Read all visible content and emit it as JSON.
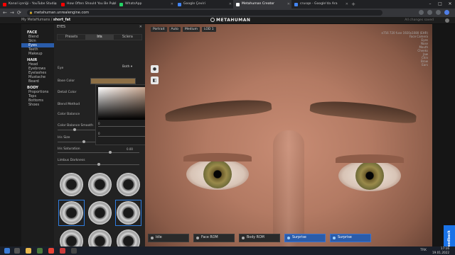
{
  "browser": {
    "tabs": [
      {
        "label": "Kanal içeriği - YouTube Studio",
        "color": "#ff0000",
        "active": false
      },
      {
        "label": "How Often Should You Be Publishing",
        "color": "#ff0000",
        "active": false
      },
      {
        "label": "WhatsApp",
        "color": "#25d366",
        "active": false
      },
      {
        "label": "Google Çeviri",
        "color": "#4285f4",
        "active": false
      },
      {
        "label": "Metahuman Creator",
        "color": "#ffffff",
        "active": true
      },
      {
        "label": "crusqe - Google'da Ara",
        "color": "#4285f4",
        "active": false
      }
    ],
    "url": "metahuman.unrealengine.com"
  },
  "app": {
    "project_prefix": "My MetaHumans  / ",
    "project_name": "short_fat",
    "brand": "METAHUMAN",
    "saved_status": "All changes saved"
  },
  "nav": {
    "groups": [
      {
        "title": "FACE",
        "items": [
          {
            "label": "Blend",
            "selected": false
          },
          {
            "label": "Skin",
            "selected": false
          },
          {
            "label": "Eyes",
            "selected": true
          },
          {
            "label": "Teeth",
            "selected": false
          },
          {
            "label": "Makeup",
            "selected": false
          }
        ]
      },
      {
        "title": "HAIR",
        "items": [
          {
            "label": "Head",
            "selected": false
          },
          {
            "label": "Eyebrows",
            "selected": false
          },
          {
            "label": "Eyelashes",
            "selected": false
          },
          {
            "label": "Mustache",
            "selected": false
          },
          {
            "label": "Beard",
            "selected": false
          }
        ]
      },
      {
        "title": "BODY",
        "items": [
          {
            "label": "Proportions",
            "selected": false
          },
          {
            "label": "Tops",
            "selected": false
          },
          {
            "label": "Bottoms",
            "selected": false
          },
          {
            "label": "Shoes",
            "selected": false
          }
        ]
      }
    ]
  },
  "panel": {
    "title": "EYES",
    "tabs": [
      "Presets",
      "Iris",
      "Sclera"
    ],
    "eye_label": "Eye",
    "eye_value": "Both",
    "base_color_label": "Base Color",
    "detail_color_label": "Detail Color",
    "blend_method_label": "Blend Method",
    "color_balance_label": "Color Balance",
    "color_balance_smooth_label": "Color Balance Smooth",
    "iris_size_label": "Iris Size",
    "iris_saturation_label": "Iris Saturation",
    "iris_saturation_value": "0.00",
    "limbus_darkness_label": "Limbus Darkness",
    "picker_values": [
      "0",
      "0.00",
      "0",
      "0.00"
    ],
    "base_color_hex": "#8d6f45"
  },
  "viewport": {
    "tools": [
      "Portrait",
      "Auto",
      "Medium",
      "LOD 1"
    ],
    "info_lines": [
      "e756 720 fuse 1920x1080 (EHR)",
      "Face Camera",
      "Eyes",
      "Nose",
      "Mouth",
      "Cheeks",
      "Jaw",
      "Chin",
      "Brow",
      "Ears"
    ],
    "bottom_controls": [
      {
        "label": "Idle",
        "active": false
      },
      {
        "label": "Face ROM",
        "active": false
      },
      {
        "label": "Body ROM",
        "active": false
      },
      {
        "label": "Surprise",
        "active": true
      },
      {
        "label": "Surprise",
        "active": true
      }
    ]
  },
  "feedback_label": "Feedback",
  "taskbar": {
    "time": "17:16",
    "date": "19.01.2022",
    "lang": "TRK"
  }
}
